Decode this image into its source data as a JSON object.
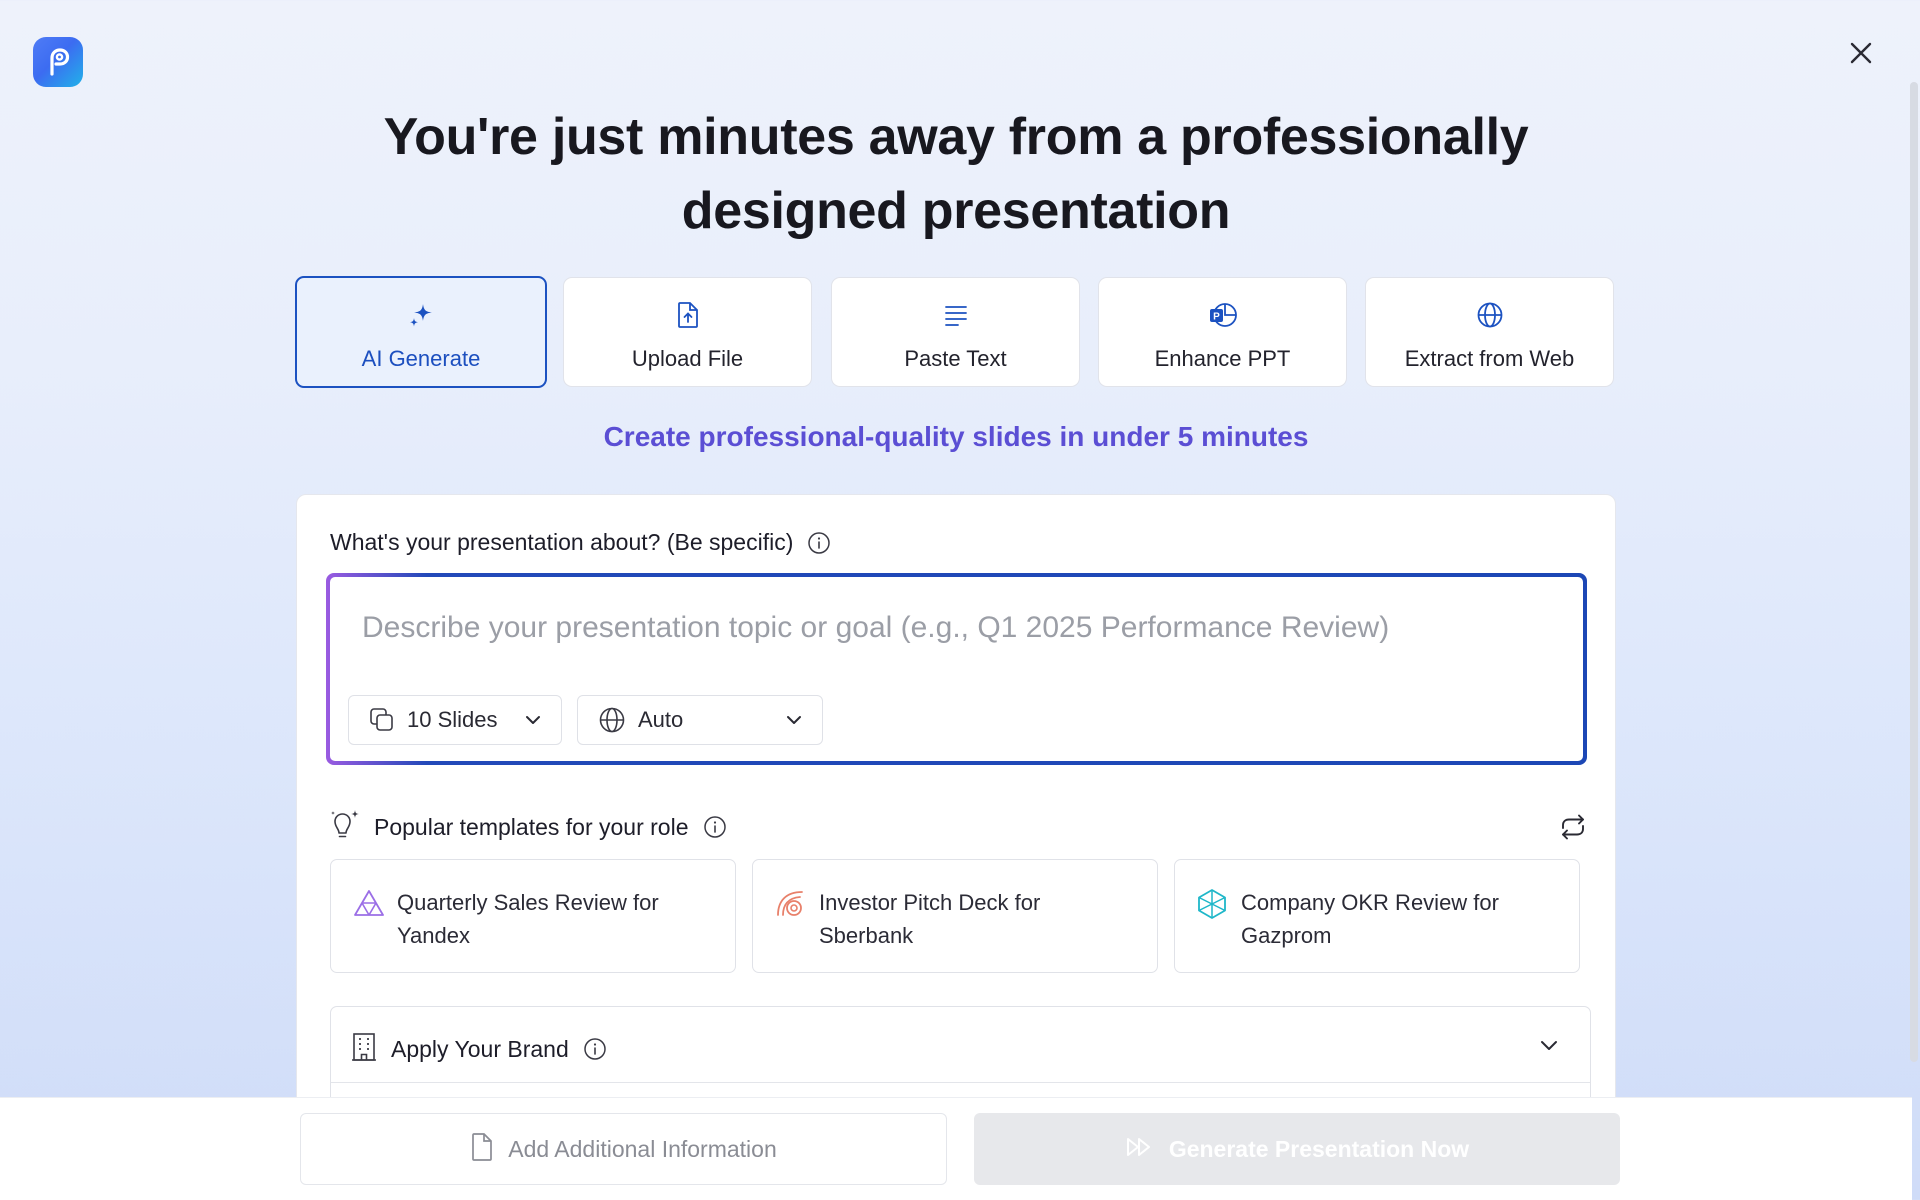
{
  "app": {
    "logo_icon": "presentation-logo-icon",
    "close_icon": "close-icon"
  },
  "headline": {
    "line1": "You're just minutes away from a professionally",
    "line2": "designed presentation"
  },
  "tabs": [
    {
      "label": "AI Generate",
      "icon": "sparkle-icon",
      "active": true
    },
    {
      "label": "Upload File",
      "icon": "file-upload-icon",
      "active": false
    },
    {
      "label": "Paste Text",
      "icon": "text-lines-icon",
      "active": false
    },
    {
      "label": "Enhance PPT",
      "icon": "powerpoint-icon",
      "active": false
    },
    {
      "label": "Extract from Web",
      "icon": "globe-icon",
      "active": false
    }
  ],
  "subhead": "Create professional-quality slides in under 5 minutes",
  "prompt": {
    "label": "What's your presentation about? (Be specific)",
    "placeholder": "Describe your presentation topic or goal (e.g., Q1 2025 Performance Review)",
    "value": "",
    "slides_select": "10 Slides",
    "language_select": "Auto"
  },
  "templates": {
    "heading": "Popular templates for your role",
    "items": [
      {
        "label": "Quarterly Sales Review for Yandex",
        "icon": "triangles-icon",
        "color": "#9b6ee6"
      },
      {
        "label": "Investor Pitch Deck for Sberbank",
        "icon": "concentric-arcs-icon",
        "color": "#e8806a"
      },
      {
        "label": "Company OKR Review for Gazprom",
        "icon": "hexagon-cube-icon",
        "color": "#1fb7c9"
      }
    ]
  },
  "brand": {
    "label": "Apply Your Brand"
  },
  "footer": {
    "add_info_label": "Add Additional Information",
    "generate_label": "Generate Presentation Now"
  },
  "colors": {
    "accent": "#1c52c1",
    "subhead": "#5b4ed4",
    "disabled_button": "#e7e8eb"
  }
}
